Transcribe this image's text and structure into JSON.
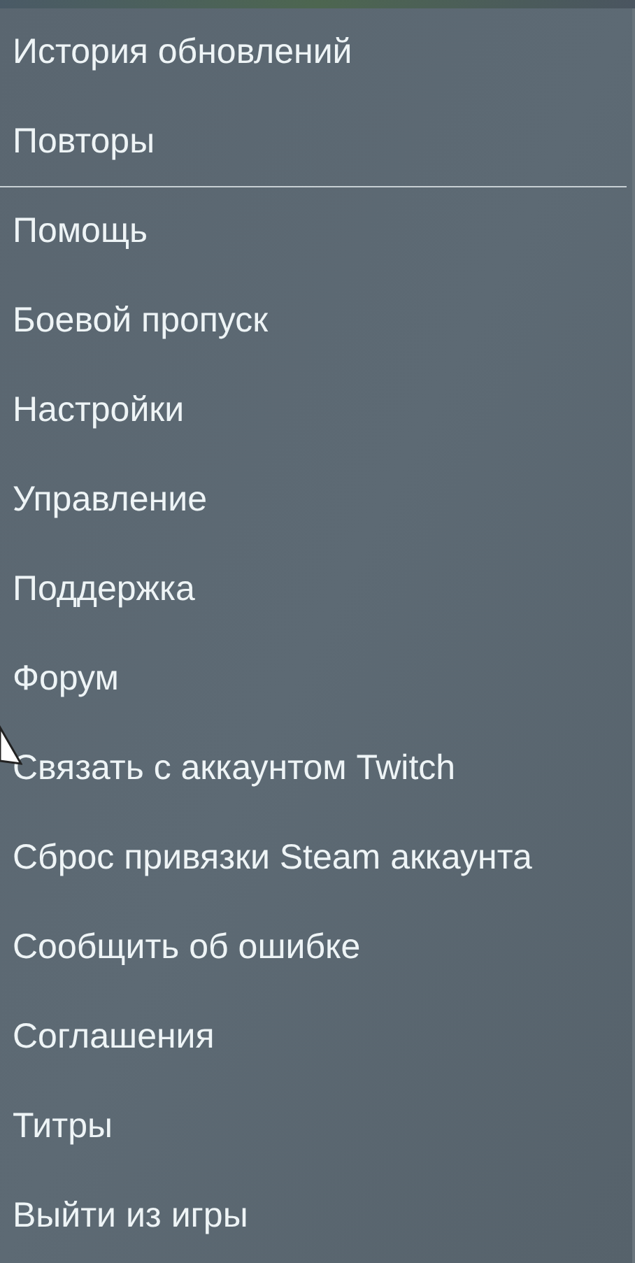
{
  "menu": {
    "items": [
      {
        "label": "История обновлений",
        "divider_after": false
      },
      {
        "label": "Повторы",
        "divider_after": true
      },
      {
        "label": "Помощь",
        "divider_after": false
      },
      {
        "label": "Боевой пропуск",
        "divider_after": false
      },
      {
        "label": "Настройки",
        "divider_after": false
      },
      {
        "label": "Управление",
        "divider_after": false
      },
      {
        "label": "Поддержка",
        "divider_after": false
      },
      {
        "label": "Форум",
        "divider_after": false
      },
      {
        "label": "Связать с аккаунтом Twitch",
        "divider_after": false
      },
      {
        "label": "Сброс привязки Steam аккаунта",
        "divider_after": false
      },
      {
        "label": "Сообщить об ошибке",
        "divider_after": false
      },
      {
        "label": "Соглашения",
        "divider_after": false
      },
      {
        "label": "Титры",
        "divider_after": false
      },
      {
        "label": "Выйти из игры",
        "divider_after": false
      }
    ]
  }
}
